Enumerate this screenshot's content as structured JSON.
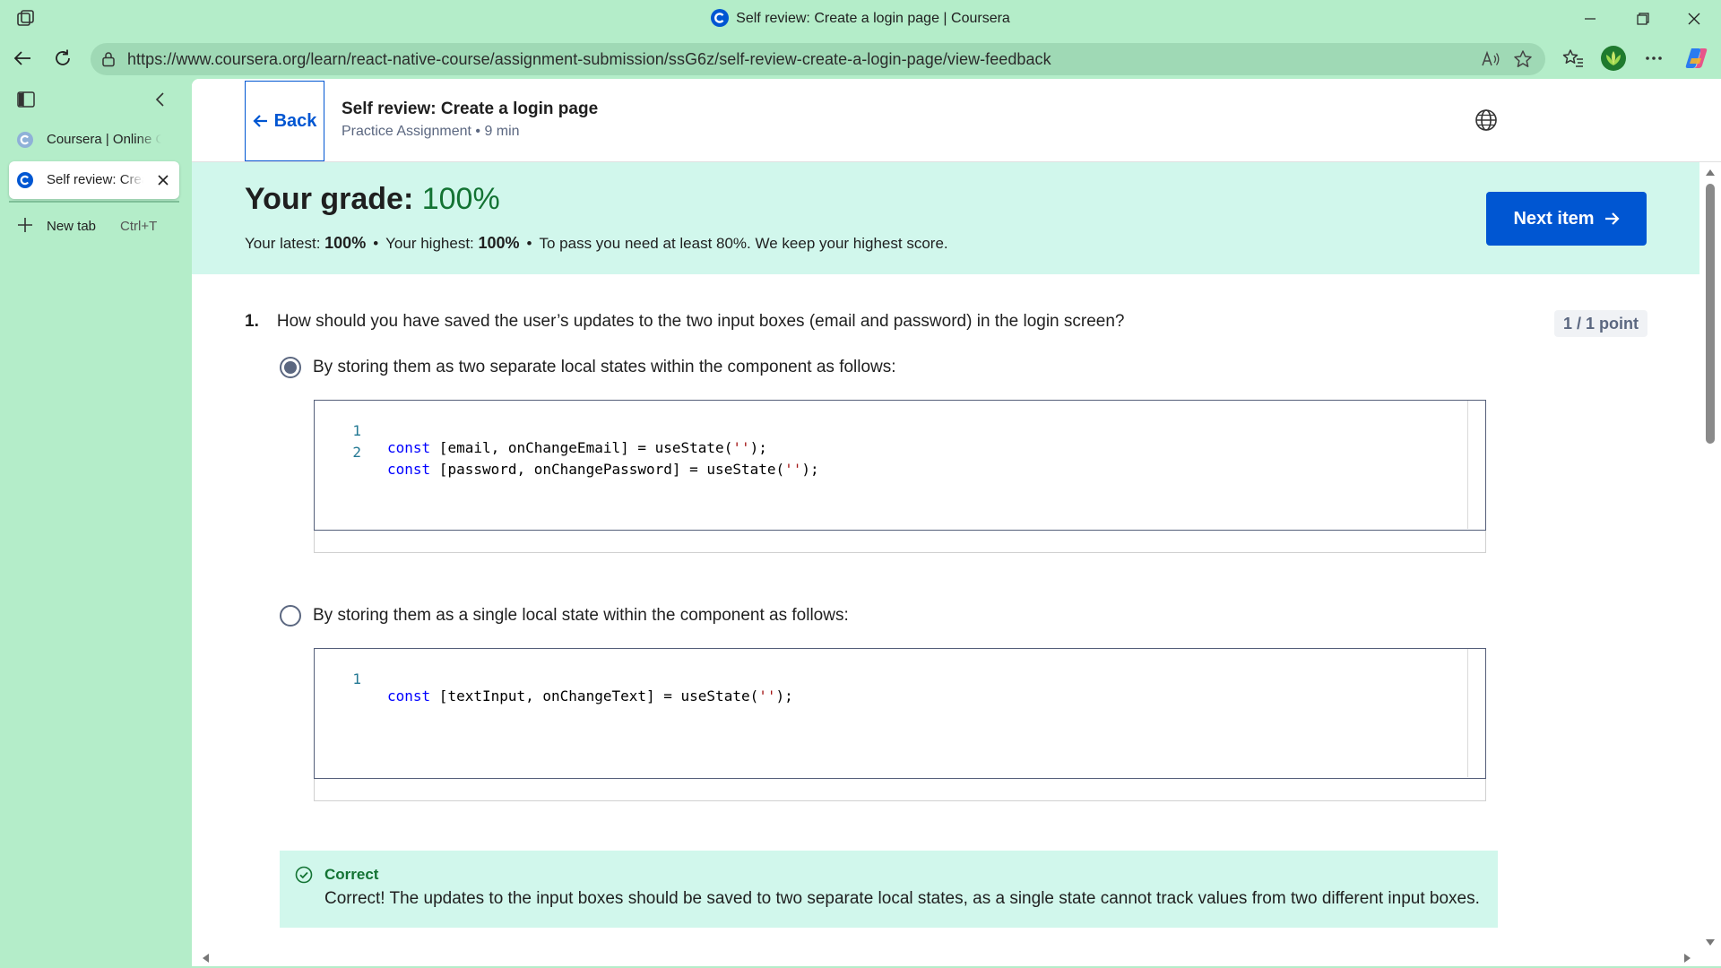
{
  "window": {
    "title": "Self review: Create a login page | Coursera",
    "minimize_icon": "minimize-icon",
    "restore_icon": "restore-icon",
    "close_icon": "close-icon"
  },
  "browser": {
    "url": "https://www.coursera.org/learn/react-native-course/assignment-submission/ssG6z/self-review-create-a-login-page/view-feedback"
  },
  "sidebar": {
    "tabs": [
      {
        "label": "Coursera | Online Co",
        "active": false
      },
      {
        "label": "Self review: Create a login page",
        "active": true
      }
    ],
    "new_tab_label": "New tab",
    "new_tab_shortcut": "Ctrl+T"
  },
  "header": {
    "back_label": "Back",
    "title": "Self review: Create a login page",
    "subtitle": "Practice Assignment • 9 min"
  },
  "grade": {
    "prefix": "Your grade: ",
    "value": "100%",
    "latest_label": "Your latest: ",
    "latest_value": "100%",
    "highest_label": "Your highest: ",
    "highest_value": "100%",
    "pass_note": "To pass you need at least 80%. We keep your highest score.",
    "next_label": "Next item"
  },
  "question": {
    "number": "1.",
    "text": "How should you have saved the user’s updates to the two input boxes (email and password) in the login screen?",
    "points": "1 / 1 point",
    "options": [
      {
        "label": "By storing them as two separate local states within the component as follows:",
        "selected": true,
        "code": [
          {
            "n": "1",
            "kw": "const",
            "rest": " [email, onChangeEmail] = useState(",
            "str": "''",
            "end": ");"
          },
          {
            "n": "2",
            "kw": "const",
            "rest": " [password, onChangePassword] = useState(",
            "str": "''",
            "end": ");"
          }
        ]
      },
      {
        "label": "By storing them as a single local state within the component as follows:",
        "selected": false,
        "code": [
          {
            "n": "1",
            "kw": "const",
            "rest": " [textInput, onChangeText] = useState(",
            "str": "''",
            "end": ");"
          }
        ]
      }
    ],
    "feedback": {
      "heading": "Correct",
      "body": "Correct! The updates to the input boxes should be saved to two separate local states, as a single state cannot track values from two different input boxes."
    }
  },
  "colors": {
    "accent": "#0056d2",
    "success": "#137333",
    "grade_bg": "#d1f7ec",
    "browser_frame": "#b4edc9"
  }
}
